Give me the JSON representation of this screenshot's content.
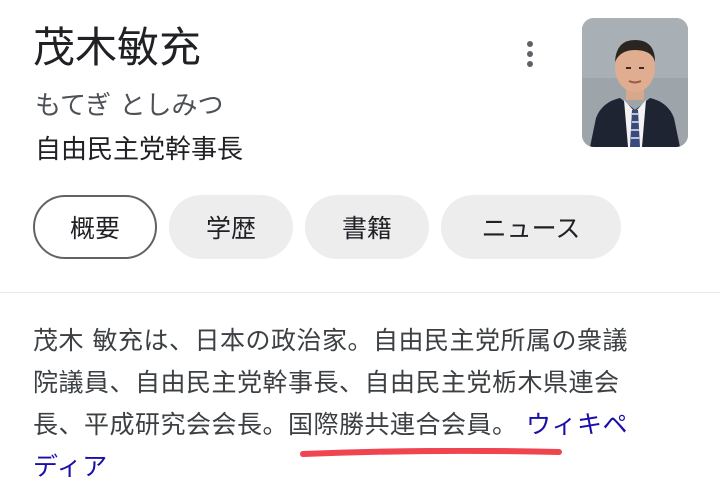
{
  "header": {
    "title": "茂木敏充",
    "reading": "もてぎ としみつ",
    "role": "自由民主党幹事長"
  },
  "icons": {
    "more": "more-vert-icon",
    "photo": "person-photo"
  },
  "tabs": [
    {
      "label": "概要",
      "active": true
    },
    {
      "label": "学歴",
      "active": false
    },
    {
      "label": "書籍",
      "active": false
    },
    {
      "label": "ニュース",
      "active": false
    }
  ],
  "description": {
    "line1": "茂木 敏充は、日本の政治家。自由民主党所属の衆議",
    "line2": "院議員、自由民主党幹事長、自由民主党栃木県連会",
    "line3": "長、平成研究会会長。国際勝共連合会員。",
    "link": "ウィキペ",
    "link2": "ディア"
  },
  "colors": {
    "link": "#1a0dab",
    "annotation": "#f0454f",
    "chip_bg": "#ededee"
  }
}
